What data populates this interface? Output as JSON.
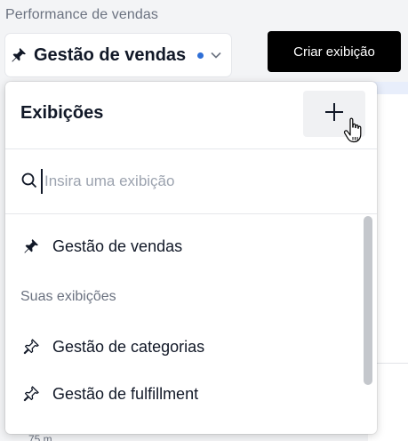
{
  "page": {
    "subtitle": "Performance de vendas"
  },
  "view_selector": {
    "current_view": "Gestão de vendas",
    "pin_icon": "pin-filled-icon",
    "unsaved_indicator_color": "#2f6fd6",
    "chevron_icon": "chevron-down-icon"
  },
  "toolbar": {
    "create_view_label": "Criar exibição"
  },
  "dropdown": {
    "title": "Exibições",
    "add_icon": "plus-icon",
    "search": {
      "placeholder": "Insira uma exibição",
      "value": ""
    },
    "pinned_items": [
      {
        "label": "Gestão de vendas",
        "icon": "pin-filled-icon"
      }
    ],
    "section_label": "Suas exibições",
    "your_views": [
      {
        "label": "Gestão de categorias",
        "icon": "pin-outline-icon"
      },
      {
        "label": "Gestão de fulfillment",
        "icon": "pin-outline-icon"
      }
    ]
  },
  "background": {
    "partial_text": "75 m"
  },
  "colors": {
    "accent": "#2f6fd6",
    "button_dark": "#000000",
    "text_primary": "#111827",
    "text_muted": "#6b7280"
  }
}
